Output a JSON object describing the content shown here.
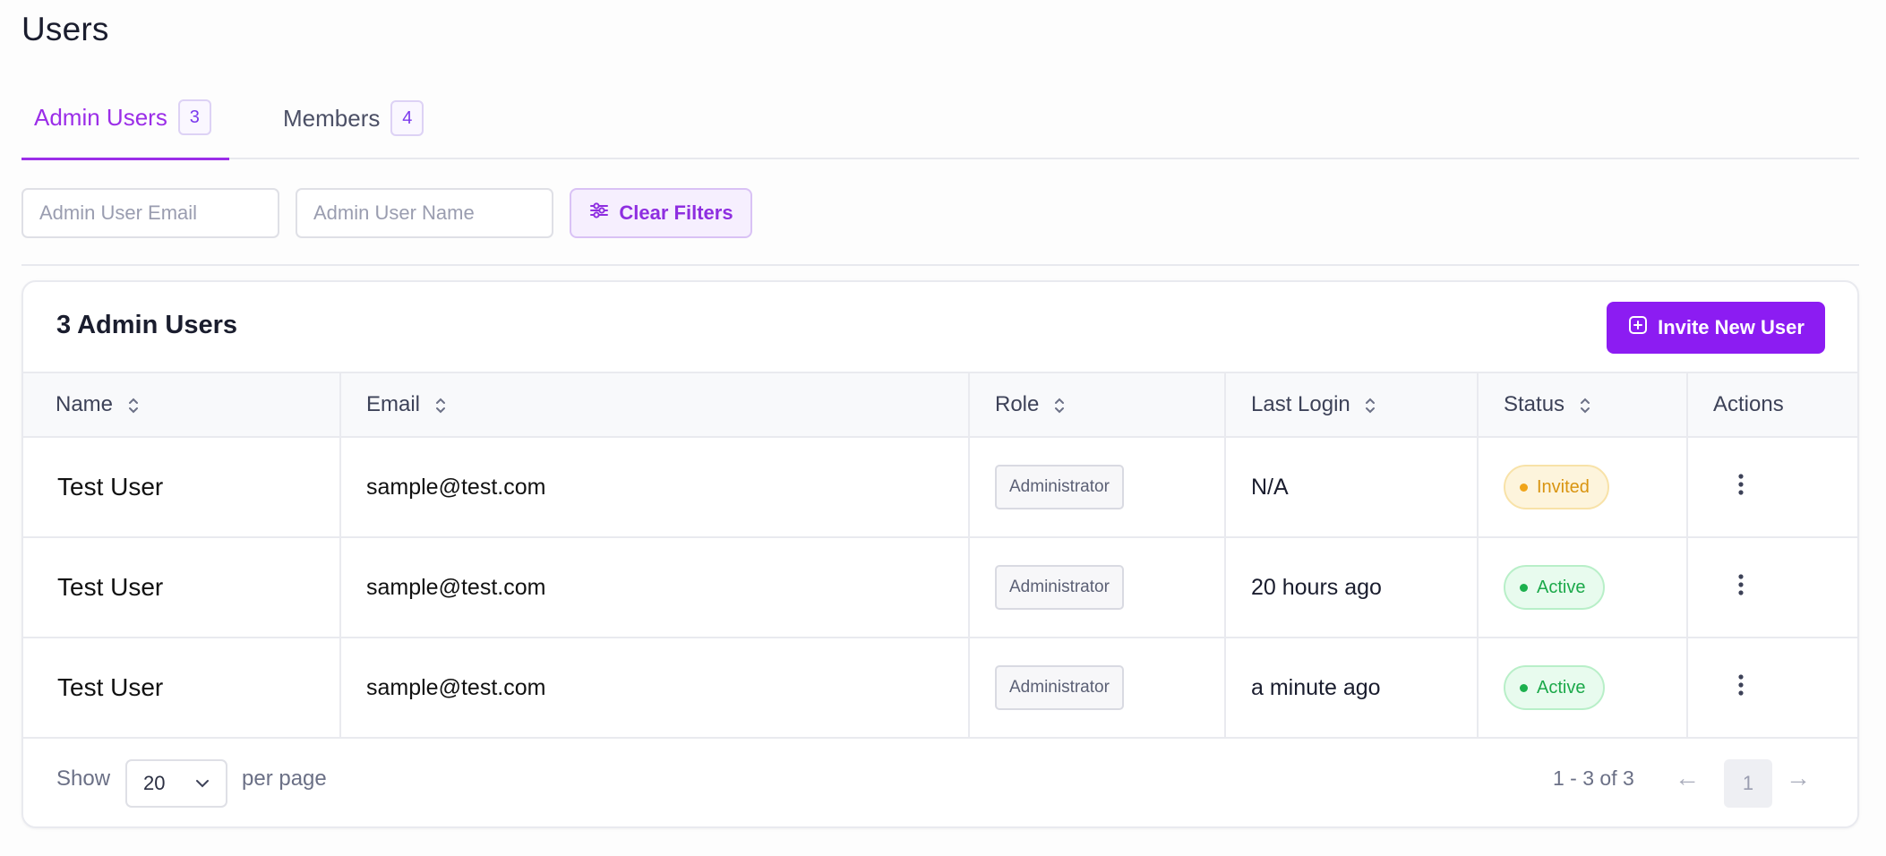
{
  "page_title": "Users",
  "tabs": [
    {
      "label": "Admin Users",
      "count": "3",
      "active": true
    },
    {
      "label": "Members",
      "count": "4",
      "active": false
    }
  ],
  "filters": {
    "email_placeholder": "Admin User Email",
    "name_placeholder": "Admin User Name",
    "clear_label": "Clear Filters"
  },
  "card": {
    "title": "3 Admin Users",
    "invite_label": "Invite New User"
  },
  "table": {
    "columns": [
      "Name",
      "Email",
      "Role",
      "Last Login",
      "Status",
      "Actions"
    ],
    "rows": [
      {
        "name": "Test User",
        "email": "sample@test.com",
        "role": "Administrator",
        "last_login": "N/A",
        "status": "Invited"
      },
      {
        "name": "Test User",
        "email": "sample@test.com",
        "role": "Administrator",
        "last_login": "20 hours ago",
        "status": "Active"
      },
      {
        "name": "Test User",
        "email": "sample@test.com",
        "role": "Administrator",
        "last_login": "a minute ago",
        "status": "Active"
      }
    ]
  },
  "footer": {
    "show_label": "Show",
    "page_size": "20",
    "per_page_label": "per page",
    "range": "1 - 3 of 3",
    "prev_icon": "←",
    "current_page": "1",
    "next_icon": "→"
  },
  "colors": {
    "accent": "#8c1cf2",
    "invited": "#d99410",
    "active": "#1ca94a"
  }
}
